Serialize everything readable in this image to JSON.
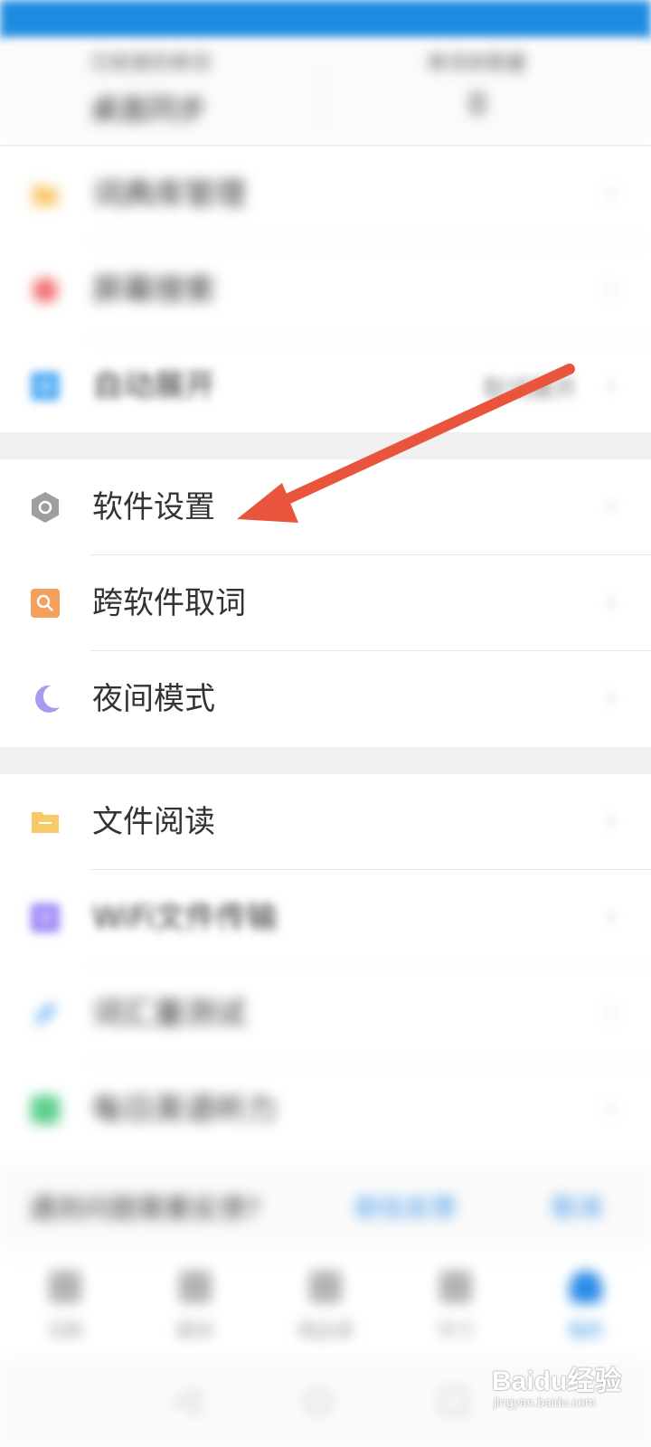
{
  "status_bar": {
    "left_text": "",
    "right_text": ""
  },
  "stats": {
    "left": {
      "label": "已收录的单词",
      "value": "桌面同步"
    },
    "right": {
      "label": "单词本数量",
      "value": "0"
    }
  },
  "group1": [
    {
      "label": "词典库管理",
      "icon": "folder-icon",
      "color": "#f9c462"
    },
    {
      "label": "屏幕搜索",
      "icon": "search-circle-icon",
      "color": "#f36f6f"
    },
    {
      "label": "自动展开",
      "icon": "plus-square-icon",
      "color": "#57aef5",
      "value": "取词展开"
    }
  ],
  "group2": [
    {
      "label": "软件设置",
      "icon": "hexagon-settings-icon",
      "color": "#9e9e9e"
    },
    {
      "label": "跨软件取词",
      "icon": "search-square-icon",
      "color": "#f4a05b"
    },
    {
      "label": "夜间模式",
      "icon": "moon-icon",
      "color": "#a89bef"
    }
  ],
  "group3": [
    {
      "label": "文件阅读",
      "icon": "folder-icon",
      "color": "#f7c969"
    },
    {
      "label": "WiFi文件传输",
      "icon": "wifi-icon",
      "color": "#9d87f5"
    },
    {
      "label": "词汇量测试",
      "icon": "pencil-icon",
      "color": "#5aa8f2"
    },
    {
      "label": "每日英语听力",
      "icon": "headphone-icon",
      "color": "#5ccf8e"
    }
  ],
  "tip": {
    "text": "遇到问题需要反馈?",
    "button1": "前往反馈",
    "button2": "取消"
  },
  "tabs": [
    {
      "label": "词典",
      "icon": "home-icon"
    },
    {
      "label": "翻译",
      "icon": "translate-icon"
    },
    {
      "label": "精品课",
      "icon": "course-icon"
    },
    {
      "label": "学习",
      "icon": "study-icon"
    },
    {
      "label": "我的",
      "icon": "user-icon",
      "active": true
    }
  ],
  "watermark": {
    "brand": "Baidu经验",
    "url": "jingyan.baidu.com"
  },
  "colors": {
    "arrow": "#e9553c",
    "accent": "#2b8ce6",
    "status_bar": "#1d8ce0"
  }
}
